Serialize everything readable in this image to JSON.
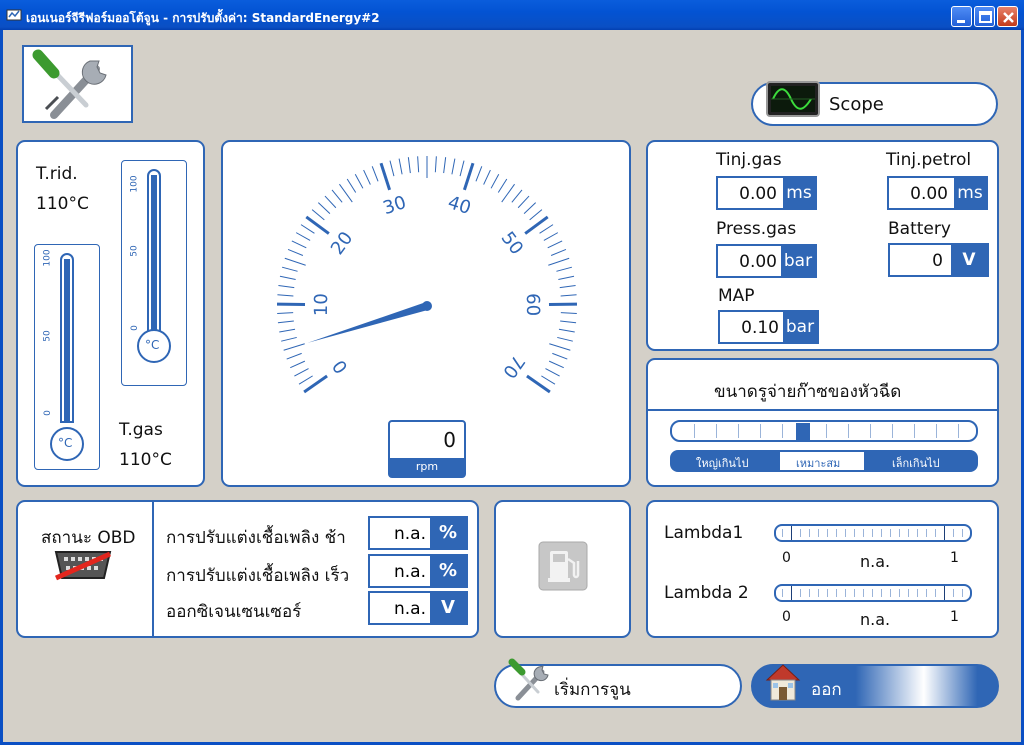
{
  "window": {
    "title": "เอนเนอร์จีรีฟอร์มออโต้จูน - การปรับตั้งค่า: StandardEnergy#2"
  },
  "scope_button": {
    "label": "Scope"
  },
  "temperatures": {
    "reducer_label": "T.rid.",
    "reducer_value": "110°C",
    "gas_label": "T.gas",
    "gas_value": "110°C",
    "scale_ticks": [
      "100",
      "50",
      "0"
    ],
    "unit": "°C"
  },
  "rpm_gauge": {
    "value": "0",
    "unit": "rpm",
    "scale_labels": [
      "0",
      "10",
      "20",
      "30",
      "40",
      "50",
      "60",
      "70"
    ],
    "needle_value": 5
  },
  "readings": {
    "tinj_gas": {
      "label": "Tinj.gas",
      "value": "0.00",
      "unit": "ms"
    },
    "tinj_petrol": {
      "label": "Tinj.petrol",
      "value": "0.00",
      "unit": "ms"
    },
    "press_gas": {
      "label": "Press.gas",
      "value": "0.00",
      "unit": "bar"
    },
    "battery": {
      "label": "Battery",
      "value": "0",
      "unit": "V"
    },
    "map": {
      "label": "MAP",
      "value": "0.10",
      "unit": "bar"
    }
  },
  "injector": {
    "title": "ขนาดรูจ่ายก๊าซของหัวฉีด",
    "options": [
      "ใหญ่เกินไป",
      "เหมาะสม",
      "เล็กเกินไป"
    ],
    "selected": "เหมาะสม",
    "position_fraction": 0.5
  },
  "obd": {
    "label": "สถานะ OBD",
    "rows": [
      {
        "label": "การปรับแต่งเชื้อเพลิง ช้า",
        "value": "n.a.",
        "unit": "%"
      },
      {
        "label": "การปรับแต่งเชื้อเพลิง เร็ว",
        "value": "n.a.",
        "unit": "%"
      },
      {
        "label": "ออกซิเจนเซนเซอร์",
        "value": "n.a.",
        "unit": "V"
      }
    ]
  },
  "lambda": {
    "rows": [
      {
        "label": "Lambda1",
        "min": "0",
        "max": "1",
        "value": "n.a."
      },
      {
        "label": "Lambda 2",
        "min": "0",
        "max": "1",
        "value": "n.a."
      }
    ]
  },
  "buttons": {
    "start_tuning": "เริ่มการจูน",
    "exit": "ออก"
  },
  "colors": {
    "accent": "#2f66b5",
    "title_bar": "#0a4fc4",
    "background": "#d4d0c8"
  },
  "icons": {
    "settings": "wrench-screwdriver-icon",
    "scope": "oscilloscope-icon",
    "obd": "obd-connector-disabled-icon",
    "fuel": "fuel-pump-icon",
    "start": "wrench-screwdriver-icon",
    "exit": "house-icon"
  }
}
